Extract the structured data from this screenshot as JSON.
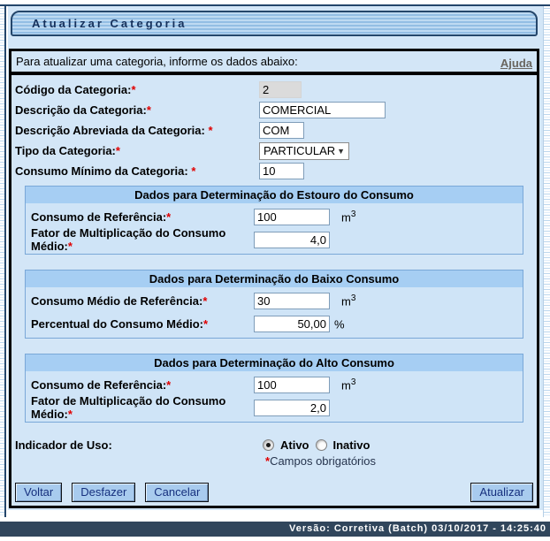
{
  "window": {
    "title": "Atualizar Categoria",
    "help_link": "Ajuda"
  },
  "instructions": "Para atualizar uma categoria, informe os dados abaixo:",
  "required_mark": "*",
  "fields": {
    "codigo": {
      "label": "Código da Categoria:",
      "value": "2"
    },
    "descricao": {
      "label": "Descrição da Categoria:",
      "value": "COMERCIAL"
    },
    "abreviada": {
      "label": "Descrição Abreviada da Categoria: ",
      "value": "COM"
    },
    "tipo": {
      "label": "Tipo da Categoria:",
      "value": "PARTICULAR",
      "arrow": "▼"
    },
    "minimo": {
      "label": "Consumo Mínimo da Categoria: ",
      "value": "10"
    }
  },
  "sections": [
    {
      "header": "Dados para Determinação do Estouro do Consumo",
      "rows": [
        {
          "label": "Consumo de Referência:",
          "value": "100",
          "unit": "m",
          "unit_sup": "3"
        },
        {
          "label": "Fator de Multiplicação do Consumo Médio:",
          "value": "4,0",
          "unit": "",
          "unit_sup": ""
        }
      ]
    },
    {
      "header": "Dados para Determinação do Baixo Consumo",
      "rows": [
        {
          "label": "Consumo Médio de Referência:",
          "value": "30",
          "unit": "m",
          "unit_sup": "3"
        },
        {
          "label": "Percentual do Consumo Médio:",
          "value": "50,00",
          "unit": "%",
          "unit_sup": ""
        }
      ]
    },
    {
      "header": "Dados para Determinação do Alto Consumo",
      "rows": [
        {
          "label": "Consumo de Referência:",
          "value": "100",
          "unit": "m",
          "unit_sup": "3"
        },
        {
          "label": "Fator de Multiplicação do Consumo Médio:",
          "value": "2,0",
          "unit": "",
          "unit_sup": ""
        }
      ]
    }
  ],
  "indicador": {
    "label": "Indicador de Uso:",
    "options": [
      {
        "label": "Ativo",
        "selected": true
      },
      {
        "label": "Inativo",
        "selected": false
      }
    ]
  },
  "required_note_text": "Campos obrigatórios",
  "buttons": {
    "voltar": "Voltar",
    "desfazer": "Desfazer",
    "cancelar": "Cancelar",
    "atualizar": "Atualizar"
  },
  "footer": {
    "version_text": "Versão: Corretiva (Batch) 03/10/2017 - 14:25:40"
  },
  "colors": {
    "page_bg": "#d3e6f7",
    "section_header_bg": "#a6cef3",
    "title_text": "#16315c",
    "footer_bg": "#31465c",
    "button_bg": "#a8cbee",
    "required_asterisk": "#e00000",
    "help_link": "#69655f",
    "border_dark": "#24466b"
  }
}
